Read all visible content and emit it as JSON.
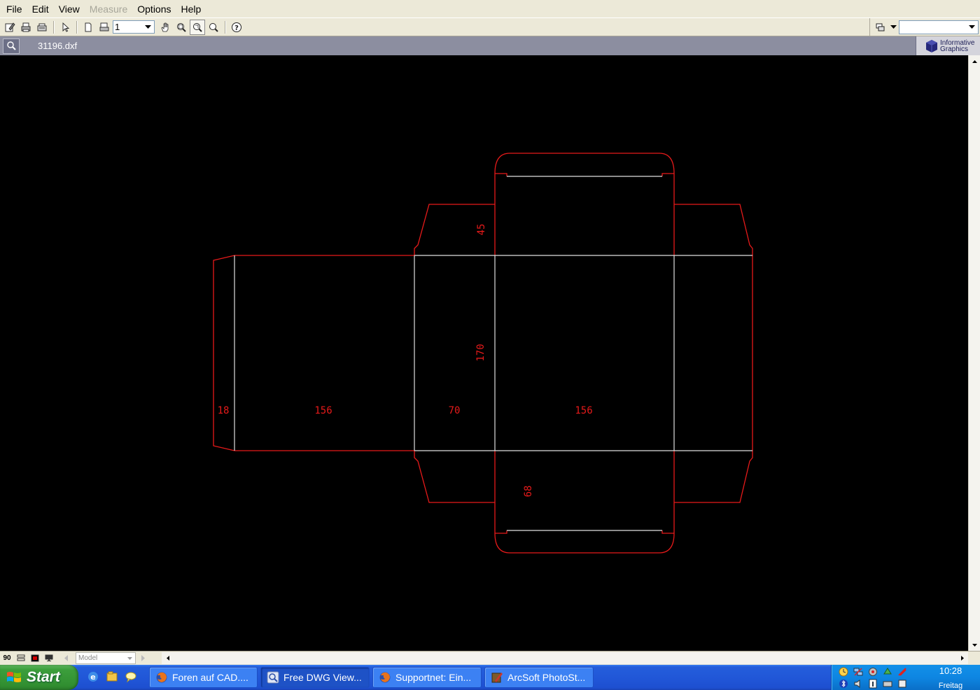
{
  "menu": {
    "file": "File",
    "edit": "Edit",
    "view": "View",
    "measure": "Measure",
    "options": "Options",
    "help": "Help"
  },
  "toolbar": {
    "page_value": "1",
    "icons": [
      "edit-icon",
      "print-icon",
      "print-preview-icon",
      "select-arrow-icon",
      "page-icon",
      "page-setup-icon",
      "pan-hand-icon",
      "zoom-window-icon",
      "zoom-extents-icon",
      "zoom-icon",
      "help-icon",
      "layers-icon"
    ],
    "right_combo_value": ""
  },
  "document": {
    "title": "31196.dxf",
    "logo_line1": "Informative",
    "logo_line2": "Graphics"
  },
  "drawing": {
    "cut_line_color": "#e61a1a",
    "fold_line_color": "#e0e0e0",
    "background": "#000000",
    "dimensions": {
      "glue_flap": "18",
      "side_panel_left": "156",
      "end_panel": "70",
      "front_panel": "156",
      "height": "170",
      "tuck_flap": "45",
      "bottom_flap": "68"
    }
  },
  "statusbar": {
    "angle": "90",
    "layout_tab": "Model"
  },
  "taskbar": {
    "start": "Start",
    "tasks": [
      {
        "label": "Foren auf CAD....",
        "icon": "firefox-icon",
        "active": false
      },
      {
        "label": "Free DWG View...",
        "icon": "dwg-viewer-icon",
        "active": true
      },
      {
        "label": "Supportnet: Ein...",
        "icon": "firefox-icon",
        "active": false
      },
      {
        "label": "ArcSoft PhotoSt...",
        "icon": "photostudio-icon",
        "active": false
      }
    ],
    "time": "10:28",
    "day": "Freitag"
  }
}
